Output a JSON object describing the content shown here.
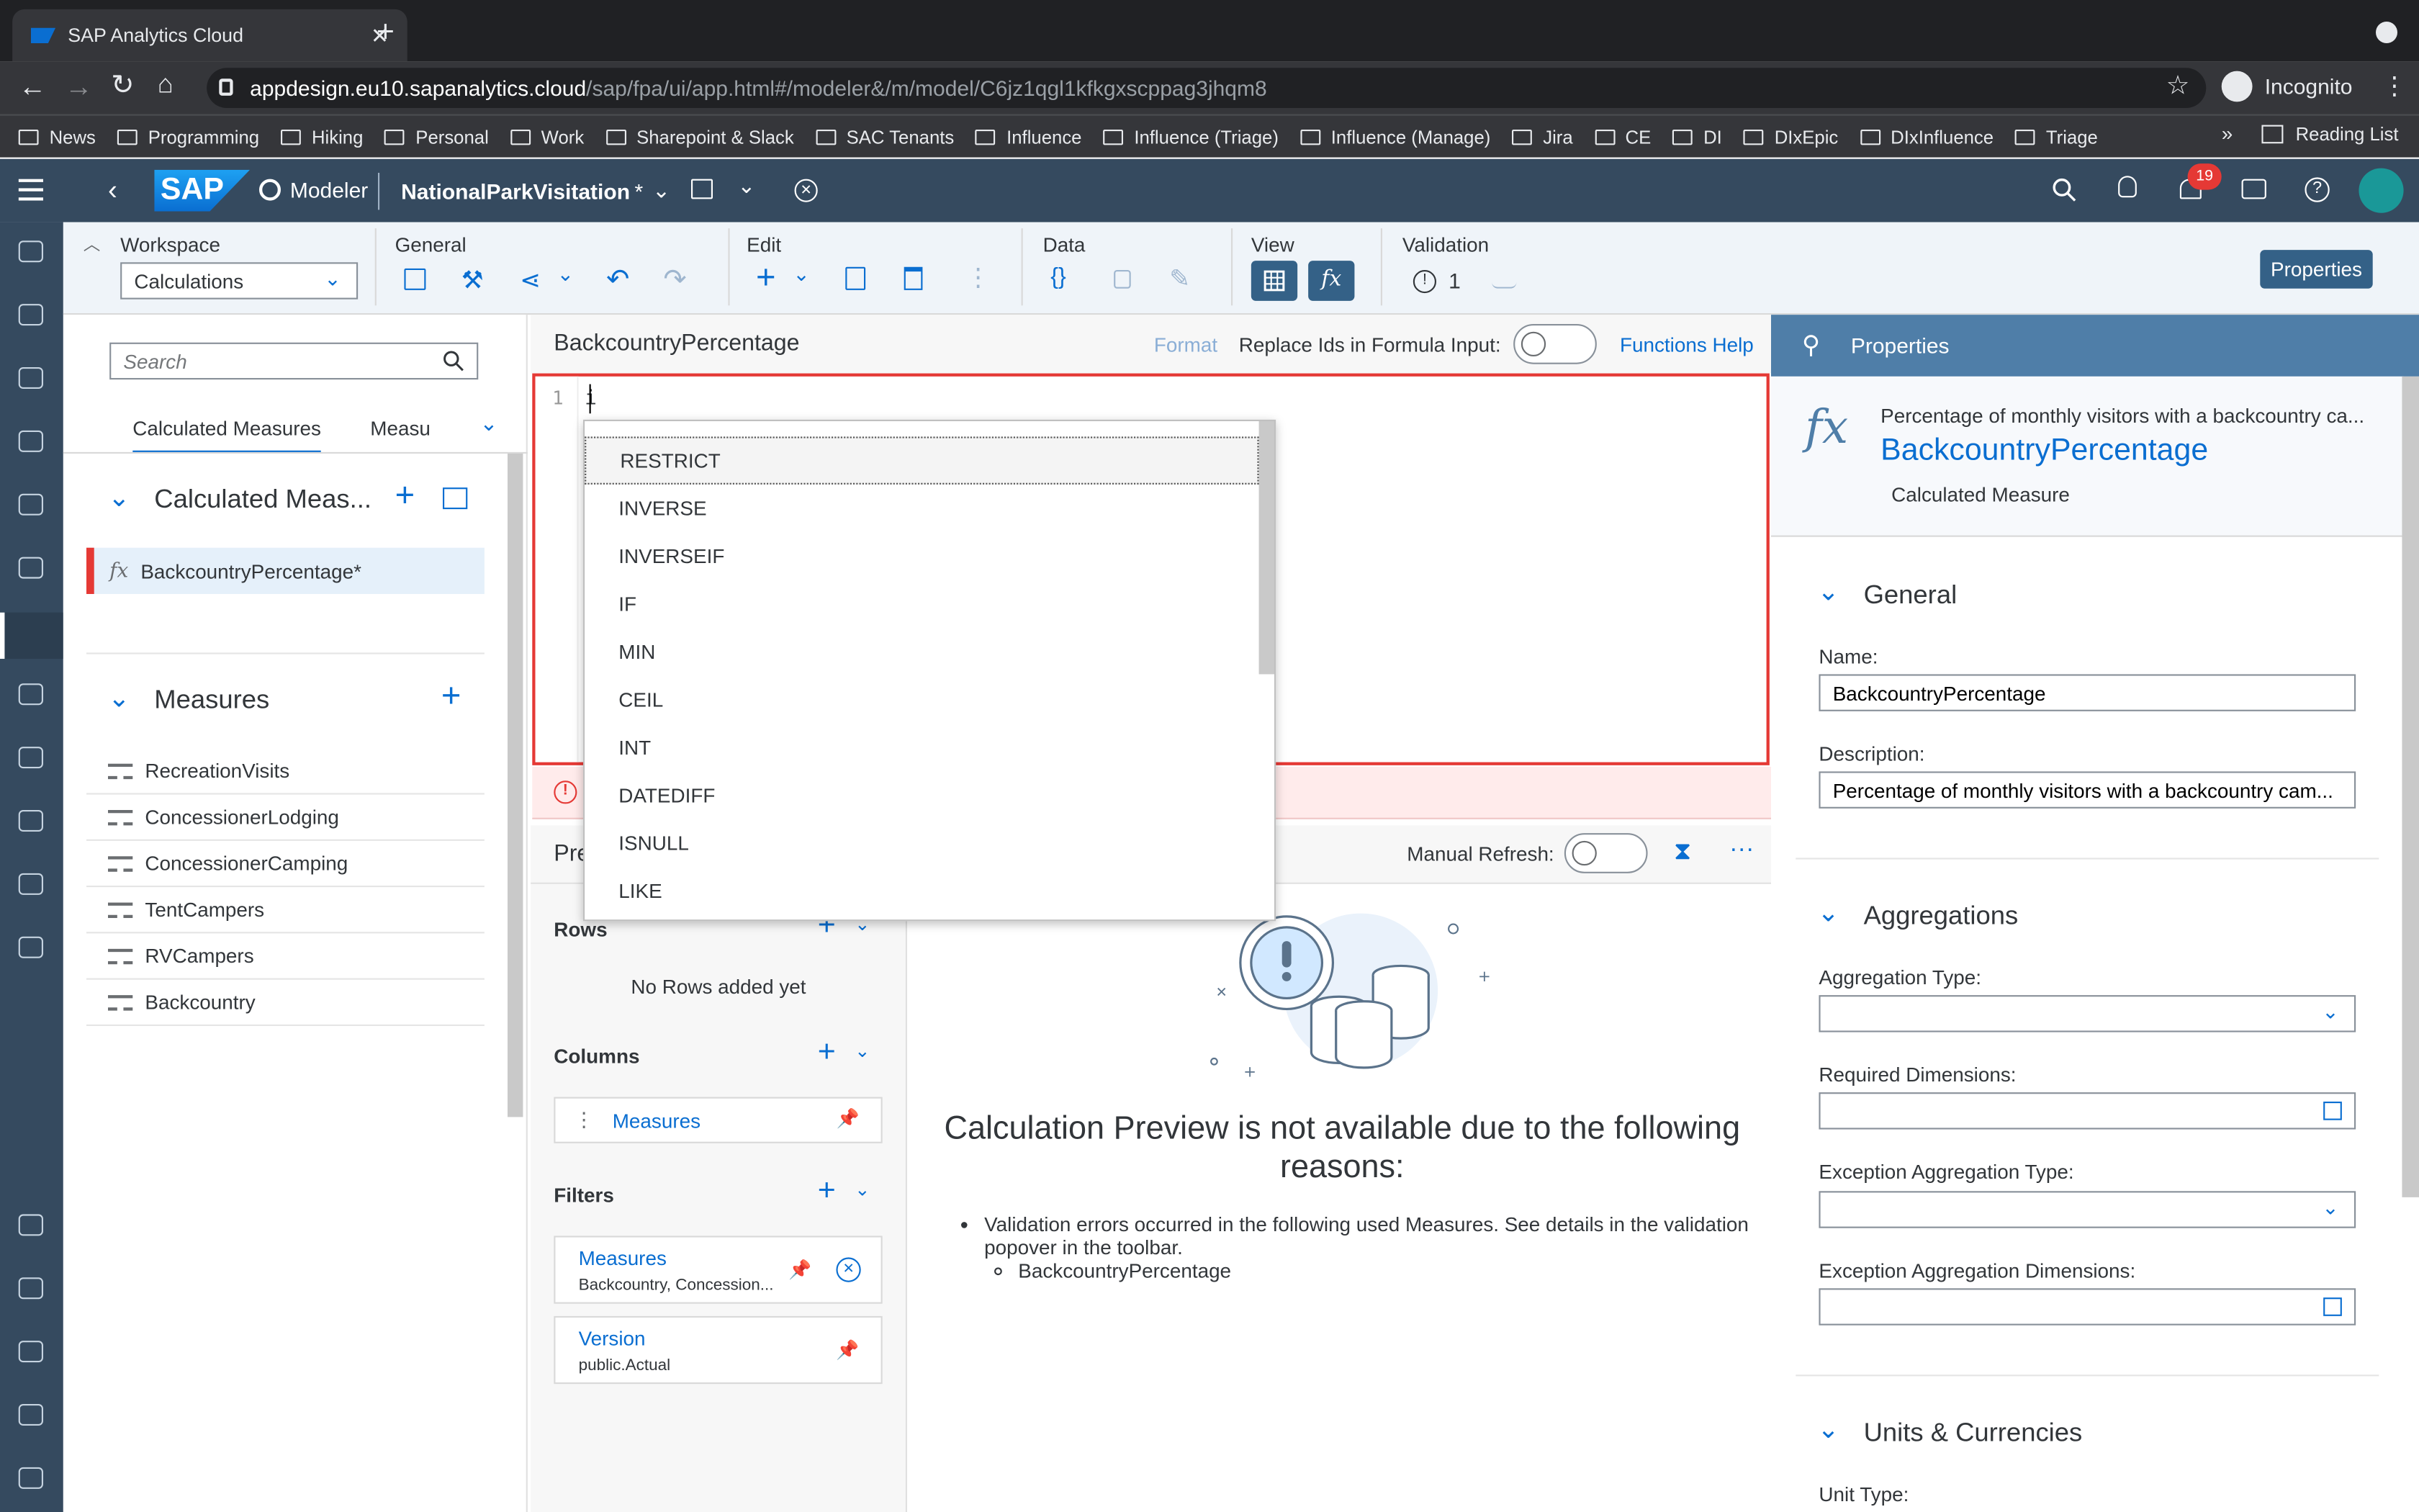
{
  "browser": {
    "tab_title": "SAP Analytics Cloud",
    "url_host": "appdesign.eu10.sapanalytics.cloud",
    "url_path": "/sap/fpa/ui/app.html#/modeler&/m/model/C6jz1qgl1kfkgxscppag3jhqm8",
    "profile": "Incognito",
    "bookmarks": [
      "News",
      "Programming",
      "Hiking",
      "Personal",
      "Work",
      "Sharepoint & Slack",
      "SAC Tenants",
      "Influence",
      "Influence (Triage)",
      "Influence (Manage)",
      "Jira",
      "CE",
      "DI",
      "DIxEpic",
      "DIxInfluence",
      "Triage"
    ],
    "bookmarks_overflow": "»",
    "reading_list": "Reading List"
  },
  "shell": {
    "logo": "SAP",
    "app": "Modeler",
    "model": "NationalParkVisitation",
    "modified_marker": "*",
    "notifications": "19"
  },
  "toolbar": {
    "workspace_label": "Workspace",
    "workspace_value": "Calculations",
    "general": "General",
    "edit": "Edit",
    "data": "Data",
    "view": "View",
    "validation": "Validation",
    "validation_count": "1",
    "properties_button": "Properties"
  },
  "left": {
    "search_placeholder": "Search",
    "tab_calc": "Calculated Measures",
    "tab_meas": "Measu",
    "calc_header": "Calculated Meas...",
    "calc_item": "BackcountryPercentage*",
    "measures_header": "Measures",
    "measures": [
      "RecreationVisits",
      "ConcessionerLodging",
      "ConcessionerCamping",
      "TentCampers",
      "RVCampers",
      "Backcountry"
    ]
  },
  "formula": {
    "name": "BackcountryPercentage",
    "format": "Format",
    "replace_ids": "Replace Ids in Formula Input:",
    "functions_help": "Functions Help",
    "line_number": "1",
    "typed": "i",
    "suggestions": [
      "RESTRICT",
      "INVERSE",
      "INVERSEIF",
      "IF",
      "MIN",
      "CEIL",
      "INT",
      "DATEDIFF",
      "ISNULL",
      "LIKE"
    ]
  },
  "preview": {
    "title": "Pre",
    "manual_refresh": "Manual Refresh:",
    "rows": "Rows",
    "no_rows": "No Rows added yet",
    "columns": "Columns",
    "columns_tile": "Measures",
    "filters": "Filters",
    "filter1_title": "Measures",
    "filter1_sub": "Backcountry, Concession...",
    "filter2_title": "Version",
    "filter2_sub": "public.Actual",
    "message_title": "Calculation Preview is not available due to the following reasons:",
    "bullet": "Validation errors occurred in the following used Measures. See details in the validation popover in the toolbar.",
    "sub_bullet": "BackcountryPercentage"
  },
  "properties": {
    "header": "Properties",
    "desc_short": "Percentage of monthly visitors with a backcountry ca...",
    "name": "BackcountryPercentage",
    "type": "Calculated Measure",
    "general": "General",
    "name_label": "Name:",
    "name_value": "BackcountryPercentage",
    "description_label": "Description:",
    "description_value": "Percentage of monthly visitors with a backcountry cam...",
    "aggregations": "Aggregations",
    "agg_type": "Aggregation Type:",
    "req_dims": "Required Dimensions:",
    "exc_agg_type": "Exception Aggregation Type:",
    "exc_agg_dims": "Exception Aggregation Dimensions:",
    "units": "Units & Currencies",
    "unit_type": "Unit Type:"
  },
  "colors": {
    "shell": "#354a5f",
    "accent": "#0a6ed1",
    "error": "#e53935",
    "badge": "#e53935"
  }
}
